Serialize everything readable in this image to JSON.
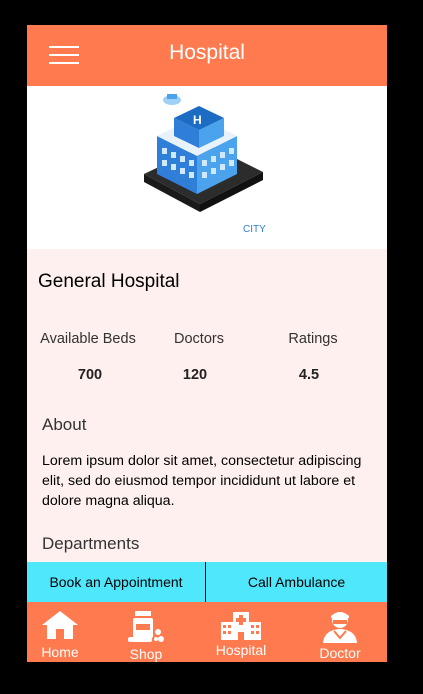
{
  "header": {
    "title": "Hospital",
    "menu_icon": "hamburger-menu-icon"
  },
  "hospital": {
    "name": "General Hospital",
    "stats": [
      {
        "label": "Available Beds",
        "value": "700"
      },
      {
        "label": "Doctors",
        "value": "120"
      },
      {
        "label": "Ratings",
        "value": "4.5"
      }
    ],
    "about_heading": "About",
    "about_text": "Lorem ipsum dolor sit amet, consectetur adipiscing elit, sed do eiusmod tempor incididunt ut labore et dolore magna aliqua.",
    "departments_heading": "Departments"
  },
  "actions": {
    "appointment": "Book an Appointment",
    "ambulance": "Call Ambulance"
  },
  "nav": [
    {
      "label": "Home",
      "icon": "home-icon"
    },
    {
      "label": "Shop",
      "icon": "medicine-shop-icon"
    },
    {
      "label": "Hospital",
      "icon": "hospital-building-icon"
    },
    {
      "label": "Doctor",
      "icon": "doctor-icon"
    }
  ],
  "colors": {
    "primary": "#ff7a4f",
    "action_bar": "#4fe7fb",
    "background": "#fdf0ee"
  }
}
